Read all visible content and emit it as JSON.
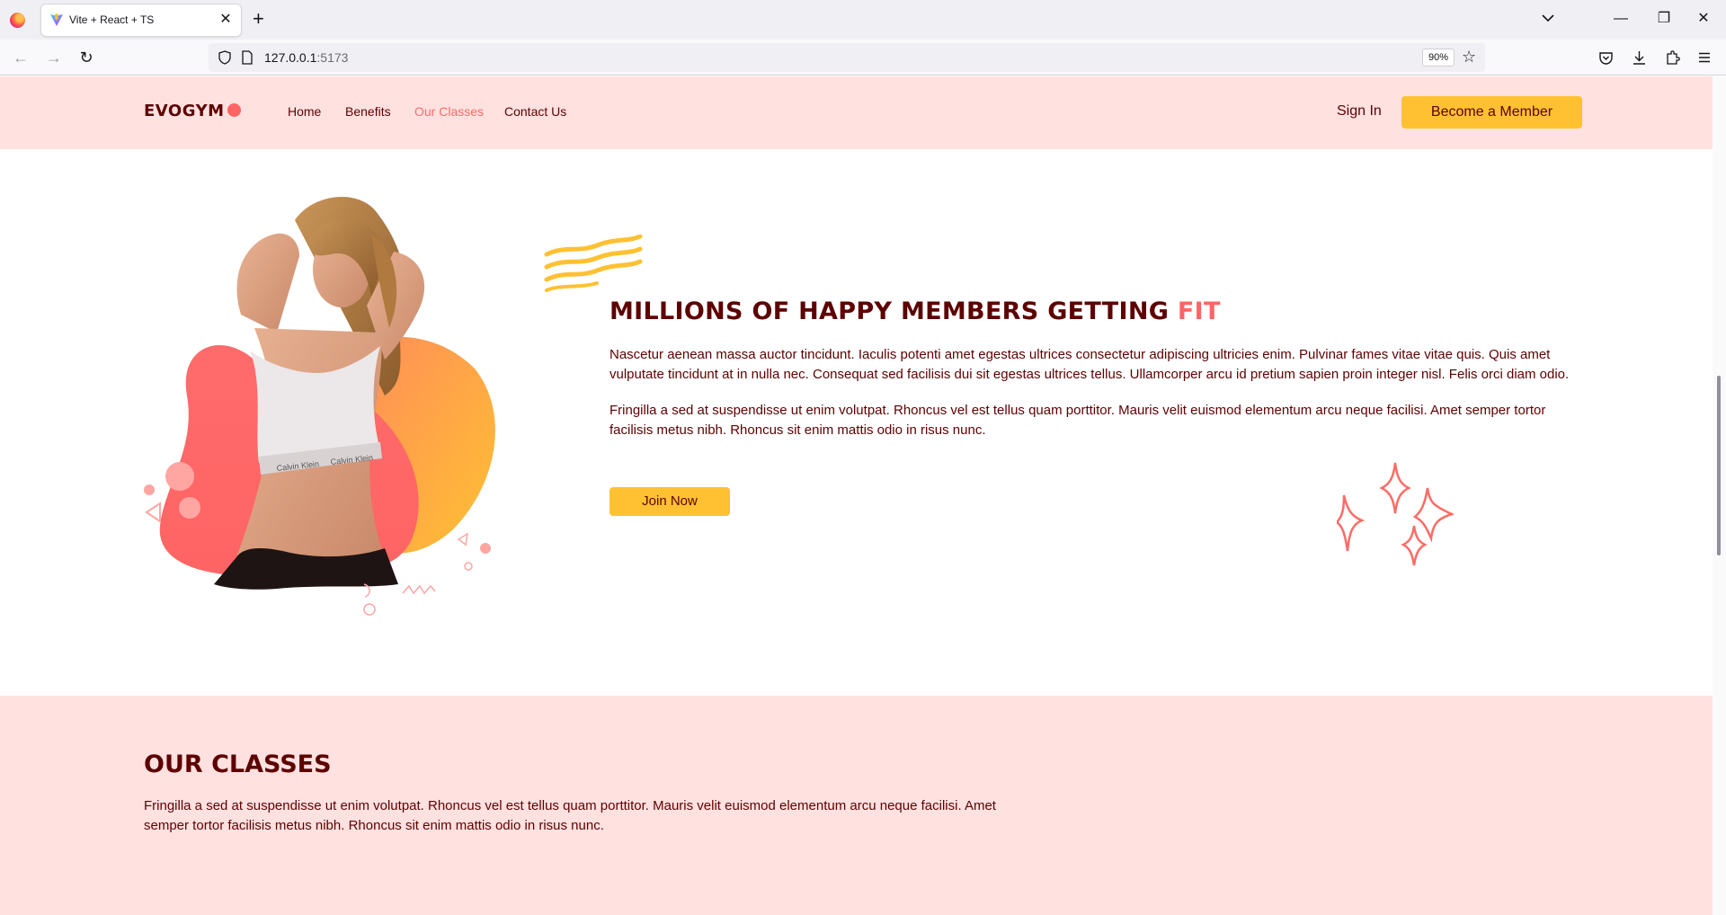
{
  "browser": {
    "tab_title": "Vite + React + TS",
    "url_host": "127.0.0.1",
    "url_port": ":5173",
    "zoom": "90%"
  },
  "site": {
    "logo": "EVOGYM",
    "nav": [
      {
        "label": "Home",
        "active": false
      },
      {
        "label": "Benefits",
        "active": false
      },
      {
        "label": "Our Classes",
        "active": true
      },
      {
        "label": "Contact Us",
        "active": false
      }
    ],
    "sign_in": "Sign In",
    "become_member": "Become a Member"
  },
  "benefits_more": {
    "title_main": "MILLIONS OF HAPPY MEMBERS GETTING ",
    "title_accent": "FIT",
    "paragraph1": "Nascetur aenean massa auctor tincidunt. Iaculis potenti amet egestas ultrices consectetur adipiscing ultricies enim. Pulvinar fames vitae vitae quis. Quis amet vulputate tincidunt at in nulla nec. Consequat sed facilisis dui sit egestas ultrices tellus. Ullamcorper arcu id pretium sapien proin integer nisl. Felis orci diam odio.",
    "paragraph2": "Fringilla a sed at suspendisse ut enim volutpat. Rhoncus vel est tellus quam porttitor. Mauris velit euismod elementum arcu neque facilisi. Amet semper tortor facilisis metus nibh. Rhoncus sit enim mattis odio in risus nunc.",
    "join_now": "Join Now",
    "image_text": "Calvin Klein"
  },
  "our_classes": {
    "title": "OUR CLASSES",
    "text": "Fringilla a sed at suspendisse ut enim volutpat. Rhoncus vel est tellus quam porttitor. Mauris velit euismod elementum arcu neque facilisi. Amet semper tortor facilisis metus nibh. Rhoncus sit enim mattis odio in risus nunc."
  },
  "colors": {
    "primary_dark": "#5e0000",
    "primary_light": "#ffe1e0",
    "accent_red": "#ff6464",
    "accent_yellow": "#ffc132"
  },
  "icons": [
    "firefox-icon",
    "vite-icon",
    "close-icon",
    "plus-icon",
    "chevron-down-icon",
    "minimize-icon",
    "restore-icon",
    "window-close-icon",
    "back-icon",
    "forward-icon",
    "reload-icon",
    "shield-icon",
    "page-icon",
    "star-icon",
    "pocket-icon",
    "download-icon",
    "extensions-icon",
    "menu-icon"
  ]
}
